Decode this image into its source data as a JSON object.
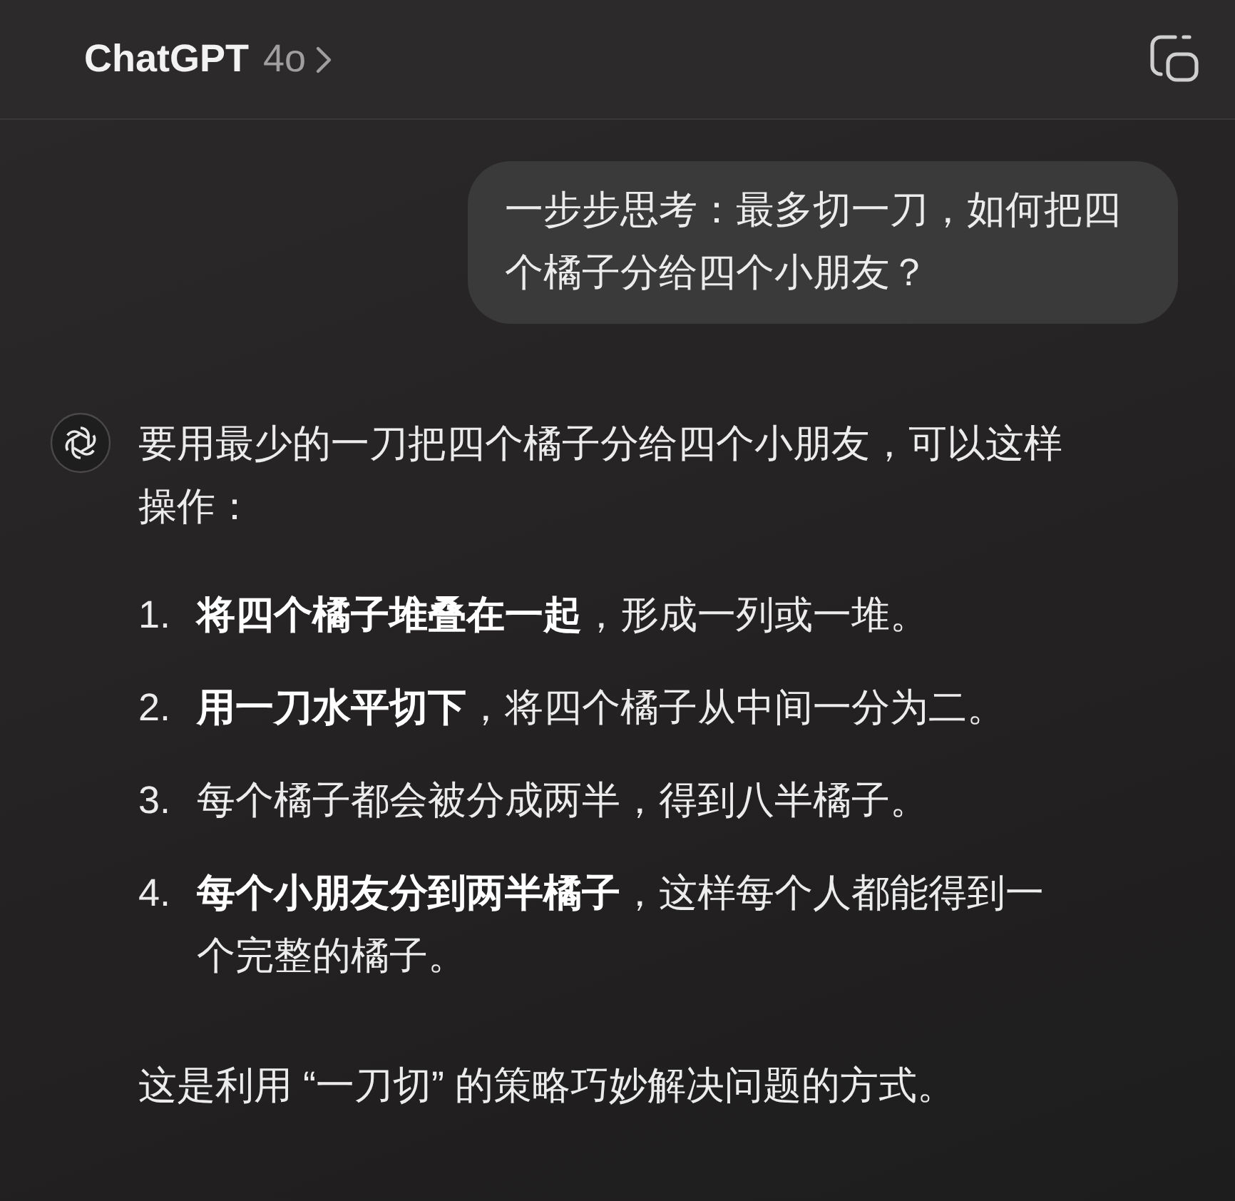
{
  "header": {
    "title": "ChatGPT",
    "model": "4o"
  },
  "user_message": {
    "text": "一步步思考：最多切一刀，如何把四个橘子分给四个小朋友？"
  },
  "assistant_message": {
    "intro": "要用最少的一刀把四个橘子分给四个小朋友，可以这样操作：",
    "steps": [
      {
        "number": "1.",
        "text": "**将四个橘子堆叠在一起**，形成一列或一堆。"
      },
      {
        "number": "2.",
        "text": "**用一刀水平切下**，将四个橘子从中间一分为二。"
      },
      {
        "number": "3.",
        "text": "每个橘子都会被分成两半，得到八半橘子。"
      },
      {
        "number": "4.",
        "text": "**每个小朋友分到两半橘子**，这样每个人都能得到一个完整的橘子。"
      }
    ],
    "conclusion": "这是利用 “一刀切” 的策略巧妙解决问题的方式。"
  }
}
